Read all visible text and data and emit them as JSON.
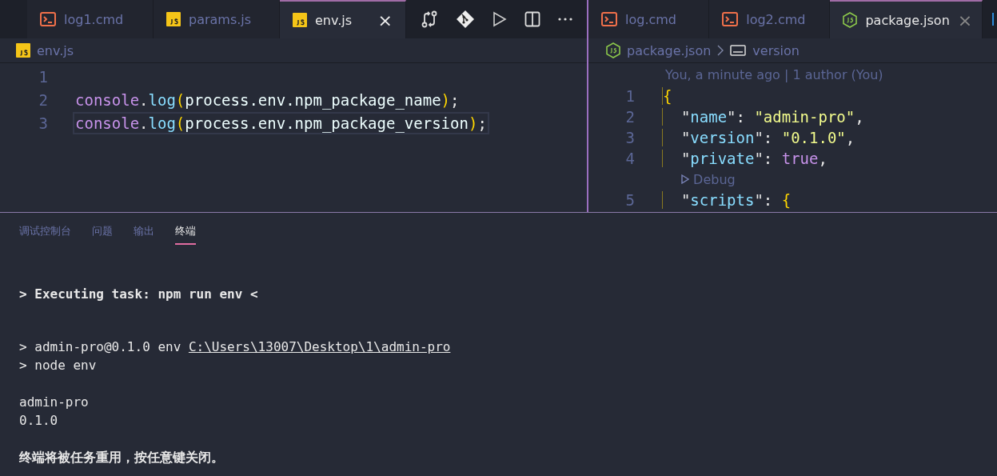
{
  "left_editor": {
    "tabs": [
      {
        "label": "log1.cmd",
        "kind": "terminal",
        "selected": false
      },
      {
        "label": "params.js",
        "kind": "js",
        "selected": false
      },
      {
        "label": "env.js",
        "kind": "js",
        "selected": true,
        "close": "×"
      }
    ],
    "breadcrumb": [
      {
        "label": "env.js",
        "kind": "js"
      }
    ],
    "lines": [
      {
        "number": "1"
      },
      {
        "number": "2",
        "tokens": [
          {
            "text": "console",
            "kind": "object"
          },
          {
            "text": ".",
            "kind": "punct"
          },
          {
            "text": "log",
            "kind": "func"
          },
          {
            "text": "(",
            "kind": "paren"
          },
          {
            "text": "process.env.npm_package_name",
            "kind": "plain"
          },
          {
            "text": ")",
            "kind": "paren"
          },
          {
            "text": ";",
            "kind": "punct"
          }
        ],
        "current": false
      },
      {
        "number": "3",
        "tokens": [
          {
            "text": "console",
            "kind": "object"
          },
          {
            "text": ".",
            "kind": "punct"
          },
          {
            "text": "log",
            "kind": "func"
          },
          {
            "text": "(",
            "kind": "paren"
          },
          {
            "text": "process.env.npm_package_version",
            "kind": "plain"
          },
          {
            "text": ")",
            "kind": "paren"
          },
          {
            "text": ";",
            "kind": "punct"
          }
        ],
        "current": true
      }
    ]
  },
  "right_editor": {
    "tabs": [
      {
        "label": "log.cmd",
        "kind": "terminal",
        "selected": false
      },
      {
        "label": "log2.cmd",
        "kind": "terminal",
        "selected": false
      },
      {
        "label": "package.json",
        "kind": "node",
        "selected": true,
        "close": "×"
      }
    ],
    "breadcrumb": [
      {
        "label": "package.json",
        "kind": "node"
      },
      {
        "label": "version",
        "kind": "text"
      }
    ],
    "blame": "You, a minute ago | 1 author (You)",
    "lines": [
      {
        "number": "1",
        "tokens": [
          {
            "text": "{",
            "kind": "paren"
          }
        ]
      },
      {
        "number": "2",
        "tokens": [
          {
            "text": "  \"",
            "kind": "punct"
          },
          {
            "text": "name",
            "kind": "key"
          },
          {
            "text": "\": ",
            "kind": "punct"
          },
          {
            "text": "\"admin-pro\"",
            "kind": "string"
          },
          {
            "text": ",",
            "kind": "punct"
          }
        ]
      },
      {
        "number": "3",
        "tokens": [
          {
            "text": "  \"",
            "kind": "punct"
          },
          {
            "text": "version",
            "kind": "key"
          },
          {
            "text": "\": ",
            "kind": "punct"
          },
          {
            "text": "\"0.1.0\"",
            "kind": "string"
          },
          {
            "text": ",",
            "kind": "punct"
          }
        ]
      },
      {
        "number": "4",
        "tokens": [
          {
            "text": "  \"",
            "kind": "punct"
          },
          {
            "text": "private",
            "kind": "key"
          },
          {
            "text": "\": ",
            "kind": "punct"
          },
          {
            "text": "true",
            "kind": "bool"
          },
          {
            "text": ",",
            "kind": "punct"
          }
        ]
      },
      {
        "codelens": "Debug"
      },
      {
        "number": "5",
        "tokens": [
          {
            "text": "  \"",
            "kind": "punct"
          },
          {
            "text": "scripts",
            "kind": "key"
          },
          {
            "text": "\": ",
            "kind": "punct"
          },
          {
            "text": "{",
            "kind": "paren"
          }
        ]
      }
    ]
  },
  "panel": {
    "tabs": [
      {
        "label": "调试控制台",
        "selected": false
      },
      {
        "label": "问题",
        "selected": false
      },
      {
        "label": "输出",
        "selected": false
      },
      {
        "label": "终端",
        "selected": true
      }
    ],
    "blocks": [
      [
        {
          "text": "> Executing task: npm run env <",
          "bold": true
        }
      ],
      [
        {
          "text": "> admin-pro@0.1.0 env ",
          "link": "C:\\Users\\13007\\Desktop\\1\\admin-pro",
          "bold": false
        },
        {
          "text": "> node env",
          "bold": false
        }
      ],
      [
        {
          "text": "admin-pro",
          "bold": false
        },
        {
          "text": "0.1.0",
          "bold": false
        }
      ],
      [
        {
          "text": "终端将被任务重用，按任意键关闭。",
          "bold": true
        }
      ]
    ]
  }
}
